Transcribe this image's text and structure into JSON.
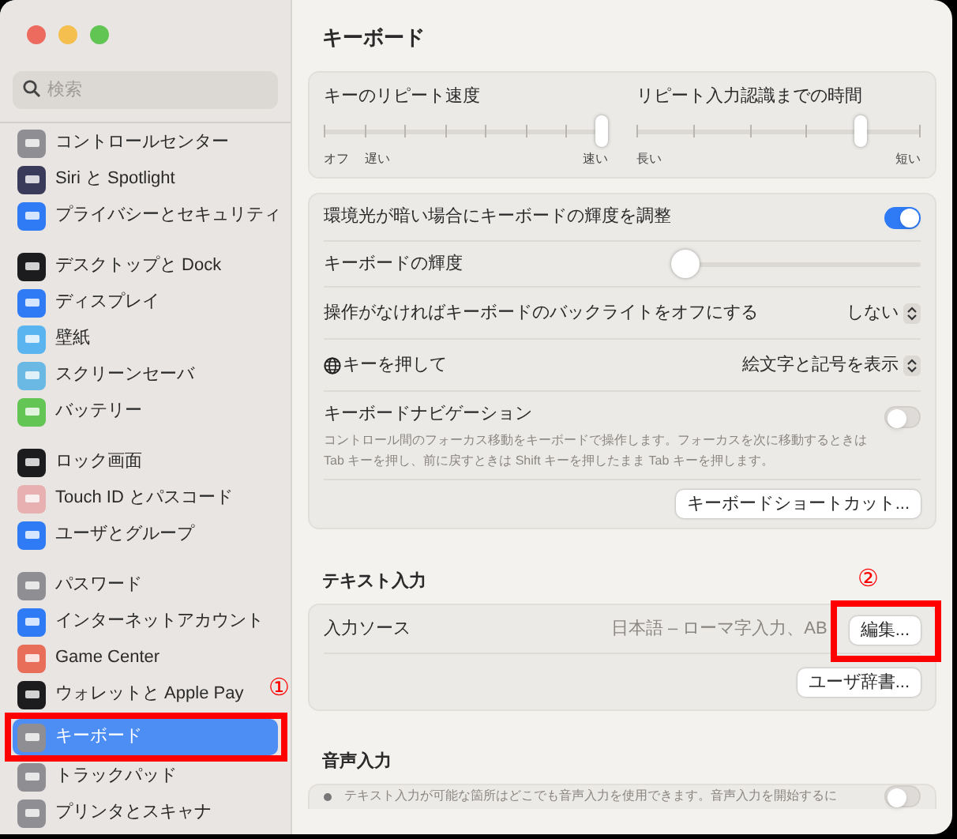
{
  "sidebar": {
    "search": {
      "placeholder": "検索"
    },
    "groups": [
      [
        {
          "label": "コントロールセンター",
          "selected": false
        },
        {
          "label": "Siri と Spotlight",
          "selected": false
        },
        {
          "label": "プライバシーとセキュリティ",
          "selected": false
        }
      ],
      [
        {
          "label": "デスクトップと Dock",
          "selected": false
        },
        {
          "label": "ディスプレイ",
          "selected": false
        },
        {
          "label": "壁紙",
          "selected": false
        },
        {
          "label": "スクリーンセーバ",
          "selected": false
        },
        {
          "label": "バッテリー",
          "selected": false
        }
      ],
      [
        {
          "label": "ロック画面",
          "selected": false
        },
        {
          "label": "Touch ID とパスコード",
          "selected": false
        },
        {
          "label": "ユーザとグループ",
          "selected": false
        }
      ],
      [
        {
          "label": "パスワード",
          "selected": false
        },
        {
          "label": "インターネットアカウント",
          "selected": false
        },
        {
          "label": "Game Center",
          "selected": false
        },
        {
          "label": "ウォレットと Apple Pay",
          "selected": false
        },
        {
          "label": "キーボード",
          "selected": true
        },
        {
          "label": "トラックパッド",
          "selected": false
        },
        {
          "label": "プリンタとスキャナ",
          "selected": false
        }
      ]
    ]
  },
  "main": {
    "title": "キーボード",
    "repeat_panel": [
      {
        "label": "キーのリピート速度",
        "level": 1,
        "low_labels": [
          "オフ",
          "遅い"
        ],
        "high_label": "速い"
      },
      {
        "label": "リピート入力認識までの時間",
        "level": 0.8,
        "low_labels": [
          "長い"
        ],
        "high_label": "短い"
      }
    ],
    "keyboard_panel": [
      {
        "kind": "toggle",
        "label": "環境光が暗い場合にキーボードの輝度を調整",
        "on": true
      },
      {
        "kind": "slider",
        "label": "キーボードの輝度",
        "level": 0
      },
      {
        "kind": "popup",
        "label": "操作がなければキーボードのバックライトをオフにする",
        "value": "しない"
      },
      {
        "kind": "popup",
        "label": "キーを押して",
        "globe": true,
        "value": "絵文字と記号を表示"
      },
      {
        "kind": "toggle",
        "label": "キーボードナビゲーション",
        "on": false,
        "description": "コントロール間のフォーカス移動をキーボードで操作します。フォーカスを次に移動するときは Tab キーを押し、前に戻すときは Shift キーを押したまま Tab キーを押します。"
      },
      {
        "kind": "button",
        "label": "キーボードショートカット..."
      }
    ],
    "text_input": {
      "heading": "テキスト入力",
      "source_label": "入力ソース",
      "source_value": "日本語 – ローマ字入力、AB",
      "edit_button": "編集...",
      "dictionary_button": "ユーザ辞書..."
    },
    "voice_input": {
      "heading": "音声入力",
      "description": "テキスト入力が可能な箇所はどこでも音声入力を使用できます。音声入力を開始するに",
      "on": false
    }
  },
  "annotations": [
    {
      "label": "①"
    },
    {
      "label": "②"
    }
  ]
}
